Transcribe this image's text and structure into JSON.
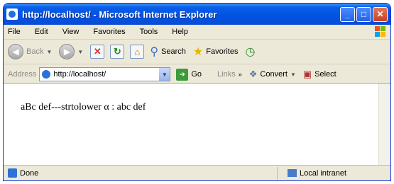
{
  "window": {
    "title": "http://localhost/ - Microsoft Internet Explorer"
  },
  "title_buttons": {
    "minimize": "_",
    "maximize": "□",
    "close": "✕"
  },
  "menu": {
    "items": [
      "File",
      "Edit",
      "View",
      "Favorites",
      "Tools",
      "Help"
    ]
  },
  "toolbar": {
    "back_label": "Back",
    "search_label": "Search",
    "favorites_label": "Favorites"
  },
  "addressbar": {
    "label": "Address",
    "url": "http://localhost/",
    "go_label": "Go",
    "links_label": "Links",
    "convert_label": "Convert",
    "select_label": "Select"
  },
  "content": {
    "text": "aBc def---strtolower α : abc def"
  },
  "status": {
    "left_text": "Done",
    "zone_text": "Local intranet"
  }
}
